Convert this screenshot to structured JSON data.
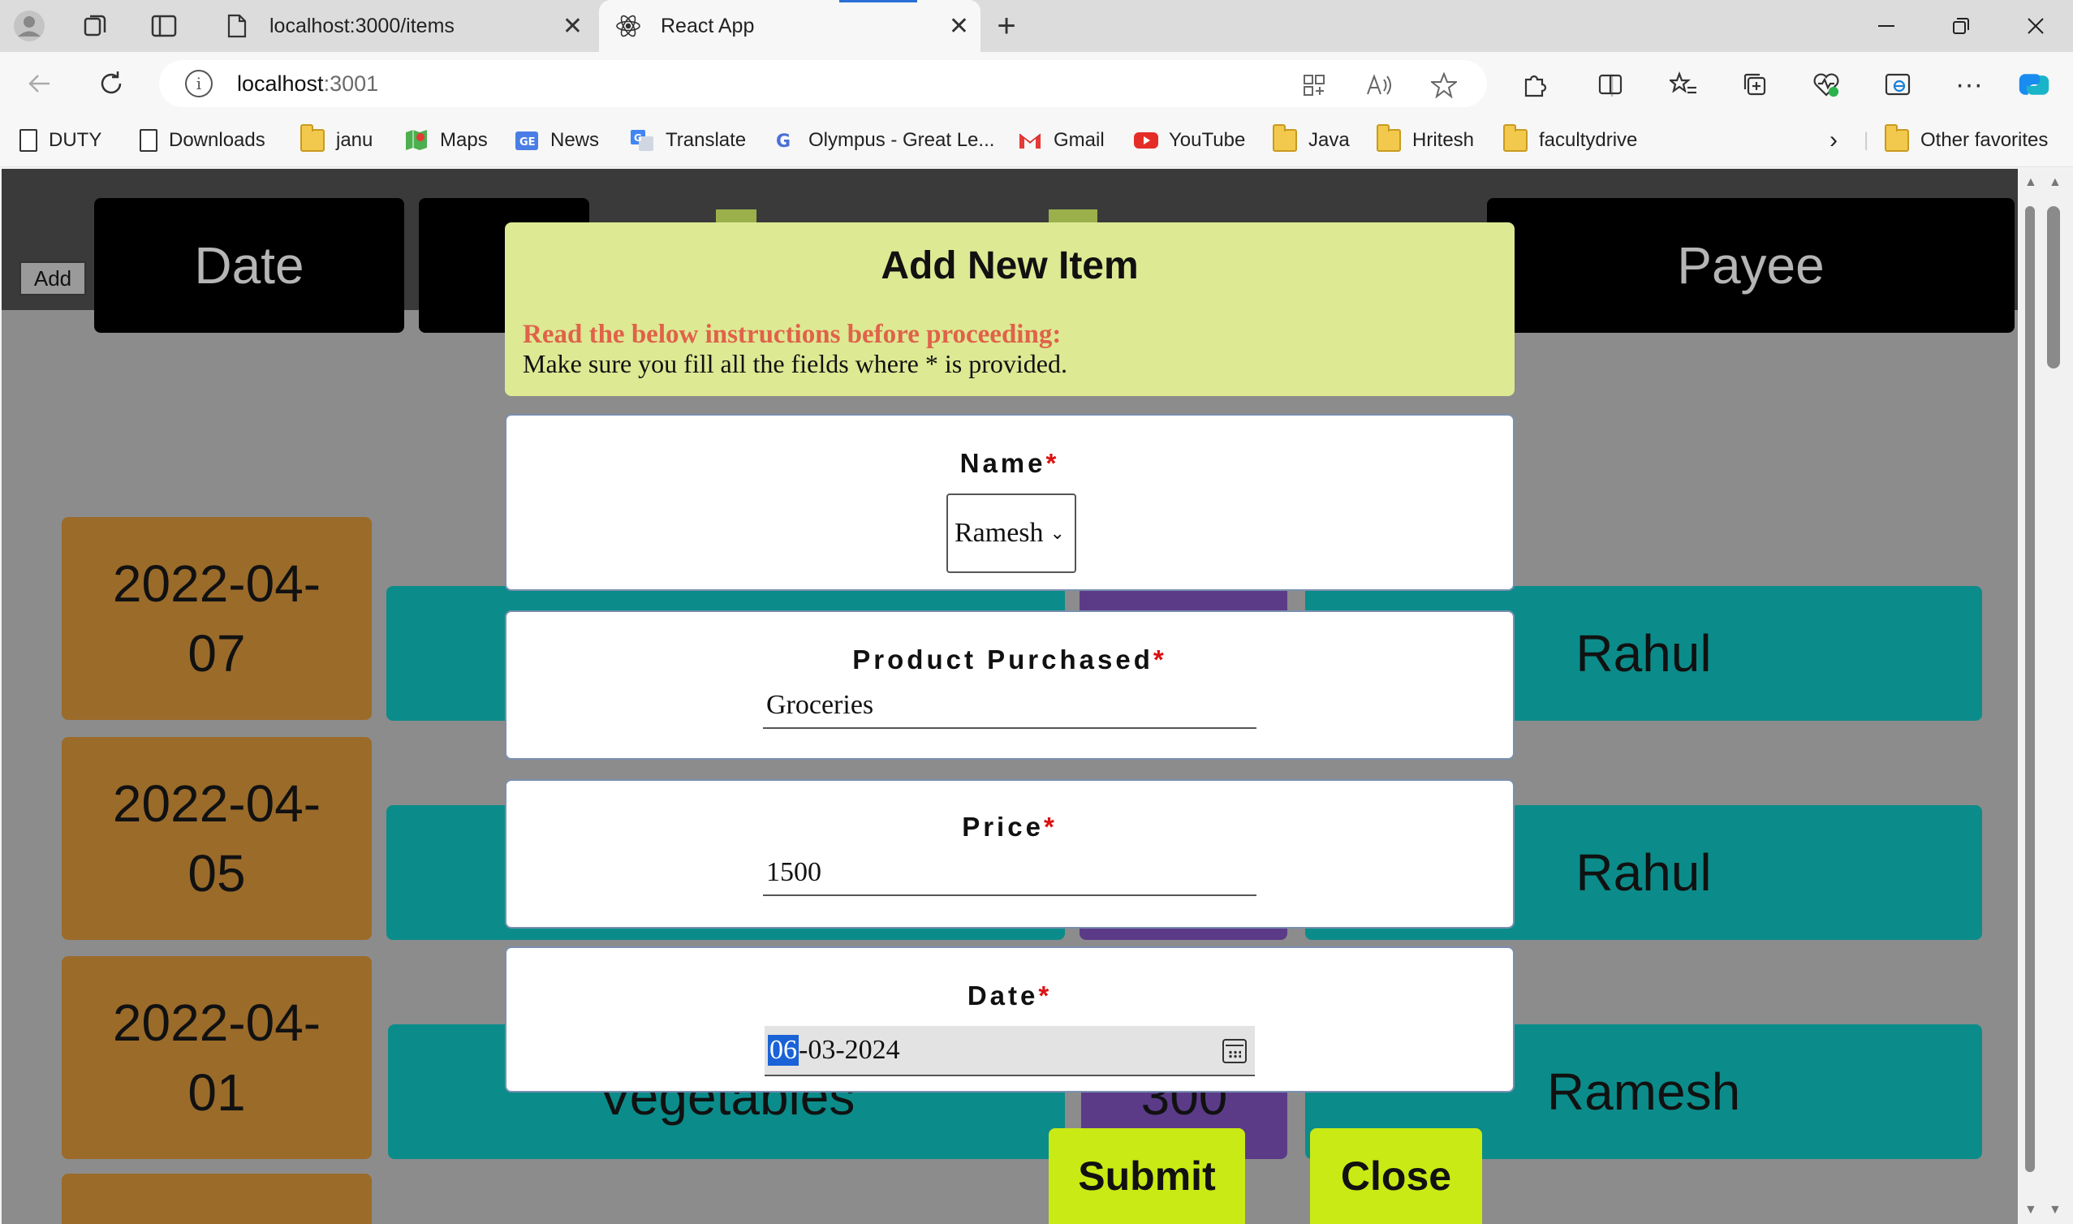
{
  "browser": {
    "tabs": [
      {
        "title": "localhost:3000/items",
        "active": false
      },
      {
        "title": "React App",
        "active": true
      }
    ],
    "address": {
      "host": "localhost",
      "port": ":3001"
    },
    "bookmarks": [
      {
        "label": "DUTY",
        "icon": "page-icon"
      },
      {
        "label": "Downloads",
        "icon": "page-icon"
      },
      {
        "label": "janu",
        "icon": "folder-icon"
      },
      {
        "label": "Maps",
        "icon": "maps-icon"
      },
      {
        "label": "News",
        "icon": "news-icon"
      },
      {
        "label": "Translate",
        "icon": "translate-icon"
      },
      {
        "label": "Olympus - Great Le...",
        "icon": "google-icon"
      },
      {
        "label": "Gmail",
        "icon": "gmail-icon"
      },
      {
        "label": "YouTube",
        "icon": "youtube-icon"
      },
      {
        "label": "Java",
        "icon": "folder-icon"
      },
      {
        "label": "Hritesh",
        "icon": "folder-icon"
      },
      {
        "label": "facultydrive",
        "icon": "folder-icon"
      }
    ],
    "other_favorites": "Other favorites"
  },
  "background_app": {
    "add_button": "Add",
    "headers": {
      "date": "Date",
      "payee": "Payee"
    },
    "rows": [
      {
        "date": "2022-04-07",
        "product": "",
        "price": "",
        "payee": "Rahul"
      },
      {
        "date": "2022-04-05",
        "product": "",
        "price": "",
        "payee": "Rahul"
      },
      {
        "date": "2022-04-01",
        "product": "Vegetables",
        "price": "300",
        "payee": "Ramesh"
      }
    ]
  },
  "modal": {
    "title": "Add New Item",
    "instructions_title": "Read the below instructions before proceeding:",
    "instructions_text": "Make sure you fill all the fields where * is provided.",
    "fields": {
      "name": {
        "label": "Name",
        "required": "*",
        "value": "Ramesh"
      },
      "product": {
        "label": "Product Purchased",
        "required": "*",
        "value": "Groceries"
      },
      "price": {
        "label": "Price",
        "required": "*",
        "value": "1500"
      },
      "date": {
        "label": "Date",
        "required": "*",
        "value_selected": "06",
        "value_rest": "-03-2024"
      }
    },
    "submit_label": "Submit",
    "close_label": "Close"
  },
  "colors": {
    "modal_header_bg": "#dde993",
    "instruction_title": "#e0624a",
    "action_button_bg": "#c9ea14",
    "date_cell_bg": "#9b6b2a",
    "row_bg": "#0b8c8a",
    "price_bg": "#5b3b88"
  }
}
